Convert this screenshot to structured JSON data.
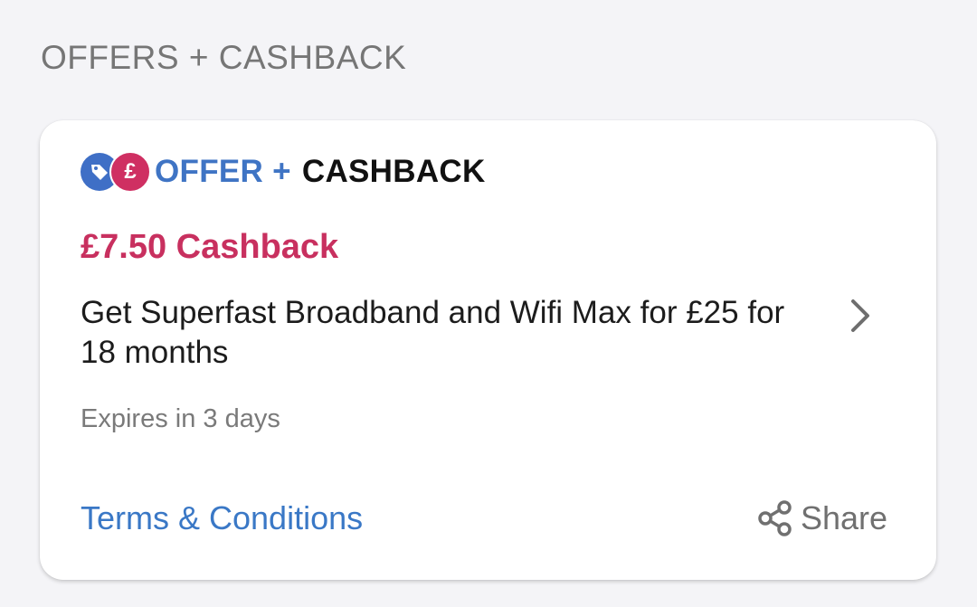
{
  "section": {
    "title": "OFFERS + CASHBACK"
  },
  "card": {
    "badge": {
      "offer_label": "OFFER +",
      "cashback_label": "CASHBACK",
      "icons": [
        "tag-icon",
        "pound-icon"
      ],
      "pound_symbol": "£"
    },
    "cashback_amount": "£7.50 Cashback",
    "description": "Get Superfast Broadband and Wifi Max for £25 for 18 months",
    "expires": "Expires in 3 days",
    "terms_label": "Terms & Conditions",
    "share_label": "Share",
    "chevron_icon": "chevron-right-icon",
    "share_icon": "share-icon"
  },
  "colors": {
    "background": "#f4f4f7",
    "offer_blue": "#3f74c4",
    "cashback_pink": "#c8305f",
    "link_blue": "#3a78c6"
  }
}
